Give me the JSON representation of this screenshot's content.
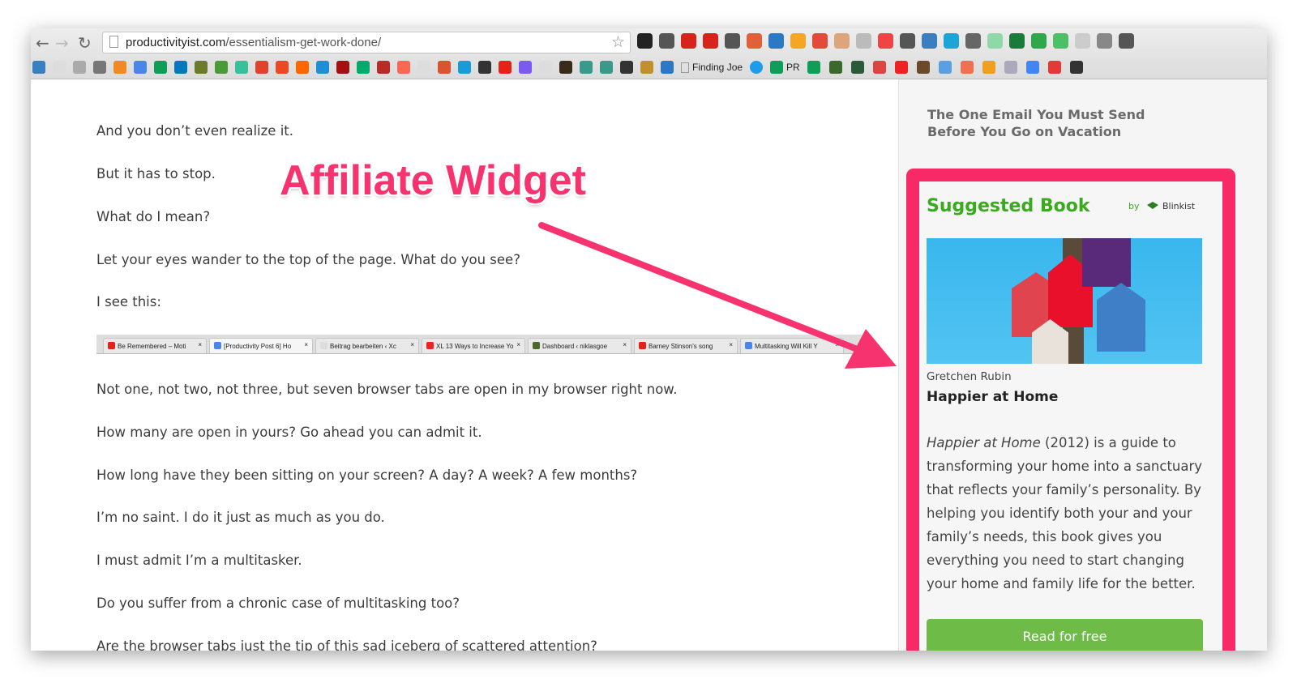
{
  "browser": {
    "url_domain": "productivityist.com",
    "url_path": "/essentialism-get-work-done/",
    "extension_icons": [
      {
        "name": "buffer-icon",
        "color": "#222"
      },
      {
        "name": "evernote-icon",
        "color": "#555"
      },
      {
        "name": "adblock-plus-icon",
        "color": "#d6231c"
      },
      {
        "name": "adblock-icon",
        "color": "#d6231c"
      },
      {
        "name": "m-icon",
        "color": "#555"
      },
      {
        "name": "target-icon",
        "color": "#e0603a"
      },
      {
        "name": "zipper-icon",
        "color": "#2b78c6"
      },
      {
        "name": "swirl-icon",
        "color": "#f5a623"
      },
      {
        "name": "counter-172-icon",
        "color": "#e24a3a"
      },
      {
        "name": "plug-icon",
        "color": "#dca67a"
      },
      {
        "name": "h-icon",
        "color": "#bbb"
      },
      {
        "name": "color-wheel-icon",
        "color": "#e44"
      },
      {
        "name": "crown-icon",
        "color": "#555"
      },
      {
        "name": "dart-icon",
        "color": "#3a7fc0"
      },
      {
        "name": "square-icon",
        "color": "#1ea5d8"
      },
      {
        "name": "search-icon",
        "color": "#666"
      },
      {
        "name": "sound-icon",
        "color": "#8fd8a8"
      },
      {
        "name": "tldr-icon",
        "color": "#1a7a3a"
      },
      {
        "name": "tag-icon",
        "color": "#2ea84a"
      },
      {
        "name": "smile-icon",
        "color": "#4cc066"
      },
      {
        "name": "ghost-icon",
        "color": "#ccc"
      },
      {
        "name": "upload-icon",
        "color": "#888"
      },
      {
        "name": "menu-icon",
        "color": "#555"
      }
    ],
    "bookmarks": [
      {
        "name": "okb-icon",
        "color": "#3a7fc0"
      },
      {
        "name": "page-icon",
        "color": "#ddd"
      },
      {
        "name": "note-icon",
        "color": "#aaa"
      },
      {
        "name": "glasses-icon",
        "color": "#777"
      },
      {
        "name": "cp-icon",
        "color": "#f08a24"
      },
      {
        "name": "docs-icon",
        "color": "#4a86e8"
      },
      {
        "name": "sheets-icon",
        "color": "#0f9d58"
      },
      {
        "name": "trello-icon",
        "color": "#0079bf"
      },
      {
        "name": "coin-icon",
        "color": "#6b7b2a"
      },
      {
        "name": "book-icon",
        "color": "#4a9a3a"
      },
      {
        "name": "bunny-icon",
        "color": "#38c09a"
      },
      {
        "name": "chart-up-icon",
        "color": "#e2412b"
      },
      {
        "name": "stumble-icon",
        "color": "#eb4924"
      },
      {
        "name": "ycombinator-icon",
        "color": "#ff6600"
      },
      {
        "name": "diamond-icon",
        "color": "#1e8fd6"
      },
      {
        "name": "bar-chart-icon",
        "color": "#a50f0f"
      },
      {
        "name": "medium-icon",
        "color": "#00ab6c"
      },
      {
        "name": "quora-icon",
        "color": "#b92b27"
      },
      {
        "name": "patreon-icon",
        "color": "#f96854"
      },
      {
        "name": "page-icon",
        "color": "#ddd"
      },
      {
        "name": "producthunt-icon",
        "color": "#da552f"
      },
      {
        "name": "circle-icon",
        "color": "#1a9bd7"
      },
      {
        "name": "e-icon",
        "color": "#333"
      },
      {
        "name": "youtube-icon",
        "color": "#e62117"
      },
      {
        "name": "chart-icon",
        "color": "#7a5af0"
      },
      {
        "name": "dim-icon",
        "color": "#ddd"
      },
      {
        "name": "portrait-icon",
        "color": "#3a2a1a"
      },
      {
        "name": "t-icon",
        "color": "#3a9a8a"
      },
      {
        "name": "t-icon",
        "color": "#3a9a8a"
      },
      {
        "name": "star-icon",
        "color": "#333"
      },
      {
        "name": "w-icon",
        "color": "#c0902a"
      },
      {
        "name": "list-icon",
        "color": "#2b78c6"
      }
    ],
    "bookmark_label_1": "Finding Joe",
    "bookmark_label_2": "PR",
    "bookmarks_after": [
      {
        "name": "sheets-icon",
        "color": "#0f9d58"
      },
      {
        "name": "layers-icon",
        "color": "#3a6a2a"
      },
      {
        "name": "inbox-icon",
        "color": "#2a5a3a"
      },
      {
        "name": "check-icon",
        "color": "#d44"
      },
      {
        "name": "tomato-icon",
        "color": "#e22"
      },
      {
        "name": "mailchimp-icon",
        "color": "#6a4a2a"
      },
      {
        "name": "feed-icon",
        "color": "#5aa0e0"
      },
      {
        "name": "ce-icon",
        "color": "#f07050"
      },
      {
        "name": "analytics-icon",
        "color": "#f0a020"
      },
      {
        "name": "calendar-icon",
        "color": "#aab"
      },
      {
        "name": "adwords-icon",
        "color": "#4285f4"
      },
      {
        "name": "pin-icon",
        "color": "#e53935"
      },
      {
        "name": "m-dark-icon",
        "color": "#333"
      }
    ]
  },
  "article": {
    "paragraphs": [
      "And you don’t even realize it.",
      "But it has to stop.",
      "What do I mean?",
      "Let your eyes wander to the top of the page. What do you see?",
      "I see this:",
      "Not one, not two, not three, but seven browser tabs are open in my browser right now.",
      "How many are open in yours? Go ahead you can admit it.",
      "How long have they been sitting on your screen? A day? A week? A few months?",
      "I’m no saint. I do it just as much as you do.",
      "I must admit I’m a multitasker.",
      "Do you suffer from a chronic case of multitasking too?",
      "Are the browser tabs just the tip of this sad iceberg of scattered attention?"
    ],
    "tabs_image": [
      {
        "label": "Be Remembered – Moti",
        "color": "#e62117"
      },
      {
        "label": "[Productivity Post 6] Ho",
        "color": "#4a86e8"
      },
      {
        "label": "Beitrag bearbeiten ‹ Xc",
        "color": "#ddd"
      },
      {
        "label": "XL 13 Ways to Increase Yo",
        "color": "#e22"
      },
      {
        "label": "Dashboard ‹ niklasgoe",
        "color": "#4a6a2a"
      },
      {
        "label": "Barney Stinson's song",
        "color": "#e62117"
      },
      {
        "label": "Multitasking Will Kill Y",
        "color": "#4a86e8"
      }
    ],
    "tab_close": "×"
  },
  "annotation": {
    "label": "Affiliate Widget",
    "color": "#f7336f"
  },
  "sidebar": {
    "related_post": "The One Email You Must Send Before You Go on Vacation",
    "widget": {
      "title": "Suggested Book",
      "by_label": "by",
      "brand": "Blinkist",
      "author": "Gretchen Rubin",
      "book_title": "Happier at Home",
      "description_italic": "Happier at Home",
      "description_rest": " (2012) is a guide to transforming your home into a sanctuary that reflects your family’s personality. By helping you identify both your and your family’s needs, this book gives you everything you need to start changing your home and family life for the better.",
      "button_label": "Read for free",
      "border_color": "#f72a67",
      "accent_color": "#3aaa1e",
      "button_color": "#6fbb48"
    }
  }
}
